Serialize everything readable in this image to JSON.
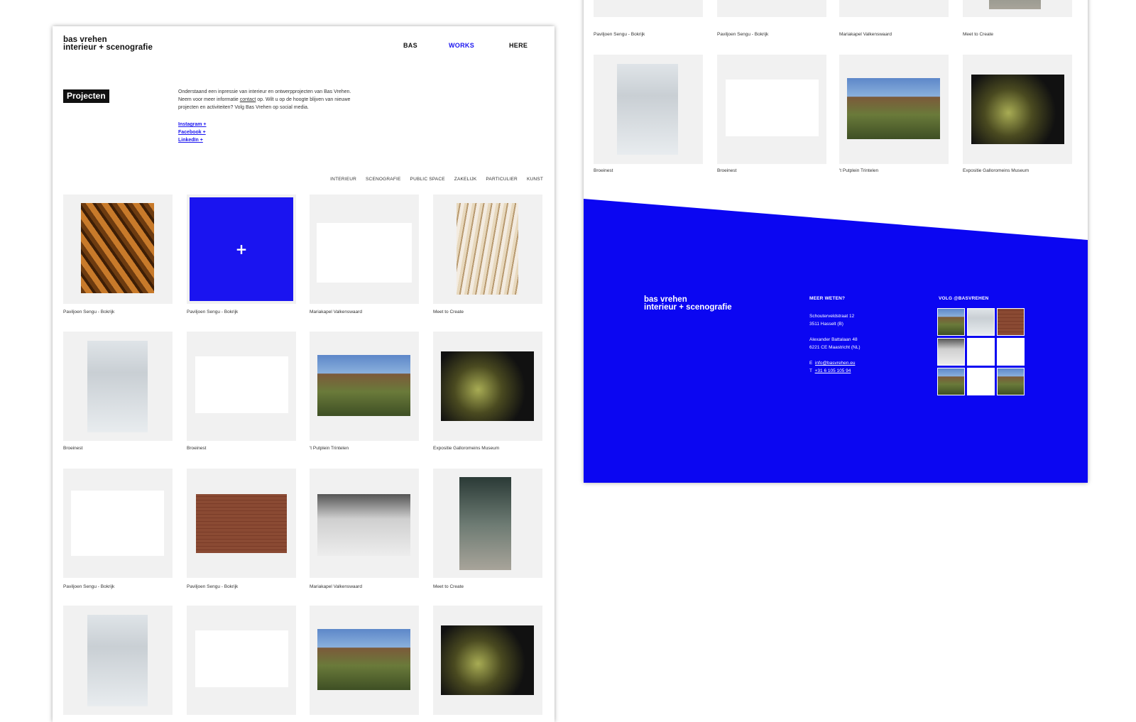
{
  "brand": {
    "line1": "bas vrehen",
    "line2": "interieur + scenografie"
  },
  "nav": {
    "bas": "BAS",
    "works": "WORKS",
    "here": "HERE"
  },
  "projecten_tag": "Projecten",
  "intro": {
    "before": "Onderstaand een inpressie van interieur en ontwerpprojecten van Bas Vrehen. Neem voor meer informatie ",
    "link": "contact",
    "after": " op. Wilt u op de hoogte blijven van nieuwe projecten en activiteiten? Volg Bas Vrehen op social media."
  },
  "social": {
    "instagram": "Instagram +",
    "facebook": "Facebook +",
    "linkedin": "LinkedIn +"
  },
  "filters": [
    "INTERIEUR",
    "SCENOGRAFIE",
    "PUBLIC SPACE",
    "ZAKELIJK",
    "PARTICULIER",
    "KUNST"
  ],
  "plus": "+",
  "projects": [
    {
      "caption": "Paviljoen Sengu - Bokrijk",
      "thumb": "wood-structure"
    },
    {
      "caption": "Paviljoen Sengu - Bokrijk",
      "thumb": "blue-hover-overlay"
    },
    {
      "caption": "Mariakapel Valkenswaard",
      "thumb": "architectural-drawing"
    },
    {
      "caption": "Meet to Create",
      "thumb": "wooden-slats"
    },
    {
      "caption": "Broeinest",
      "thumb": "staircase"
    },
    {
      "caption": "Broeinest",
      "thumb": "floor-plan"
    },
    {
      "caption": "'t Putplein Trintelen",
      "thumb": "village-square"
    },
    {
      "caption": "Expositie Galloromeins Museum",
      "thumb": "museum-exhibit"
    },
    {
      "caption": "Paviljoen Sengu - Bokrijk",
      "thumb": "line-drawing"
    },
    {
      "caption": "Paviljoen Sengu - Bokrijk",
      "thumb": "brick-building"
    },
    {
      "caption": "Mariakapel Valkenswaard",
      "thumb": "corridor"
    },
    {
      "caption": "Meet to Create",
      "thumb": "hall-interior"
    },
    {
      "caption": "",
      "thumb": "staircase"
    },
    {
      "caption": "",
      "thumb": "floor-plan"
    },
    {
      "caption": "",
      "thumb": "village-square"
    },
    {
      "caption": "",
      "thumb": "museum-exhibit"
    }
  ],
  "right_projects": [
    {
      "caption": "Paviljoen Sengu - Bokrijk"
    },
    {
      "caption": "Paviljoen Sengu - Bokrijk"
    },
    {
      "caption": "Mariakapel Valkenswaard"
    },
    {
      "caption": "Meet to Create"
    },
    {
      "caption": "Broeinest",
      "thumb": "staircase"
    },
    {
      "caption": "Broeinest",
      "thumb": "floor-plan"
    },
    {
      "caption": "'t Putplein Trintelen",
      "thumb": "village-square"
    },
    {
      "caption": "Expositie Galloromeins Museum",
      "thumb": "museum-exhibit"
    }
  ],
  "footer": {
    "brand1": "bas vrehen",
    "brand2": "interieur + scenografie",
    "meer_weten": "MEER WETEN?",
    "addr1a": "Schouterveldstraat 12",
    "addr1b": "3511 Hasselt (B)",
    "addr2a": "Alexander Battalaan 48",
    "addr2b": "6221 CE Maastricht (NL)",
    "email_label": "E",
    "email": "info@basvrehen.eu",
    "phone_label": "T",
    "phone": "+31 6 105 105 94",
    "volg": "VOLG @BASVREHEN"
  },
  "colors": {
    "accent": "#1a14f0",
    "footer": "#0b06f2",
    "card_bg": "#f1f1f1"
  }
}
